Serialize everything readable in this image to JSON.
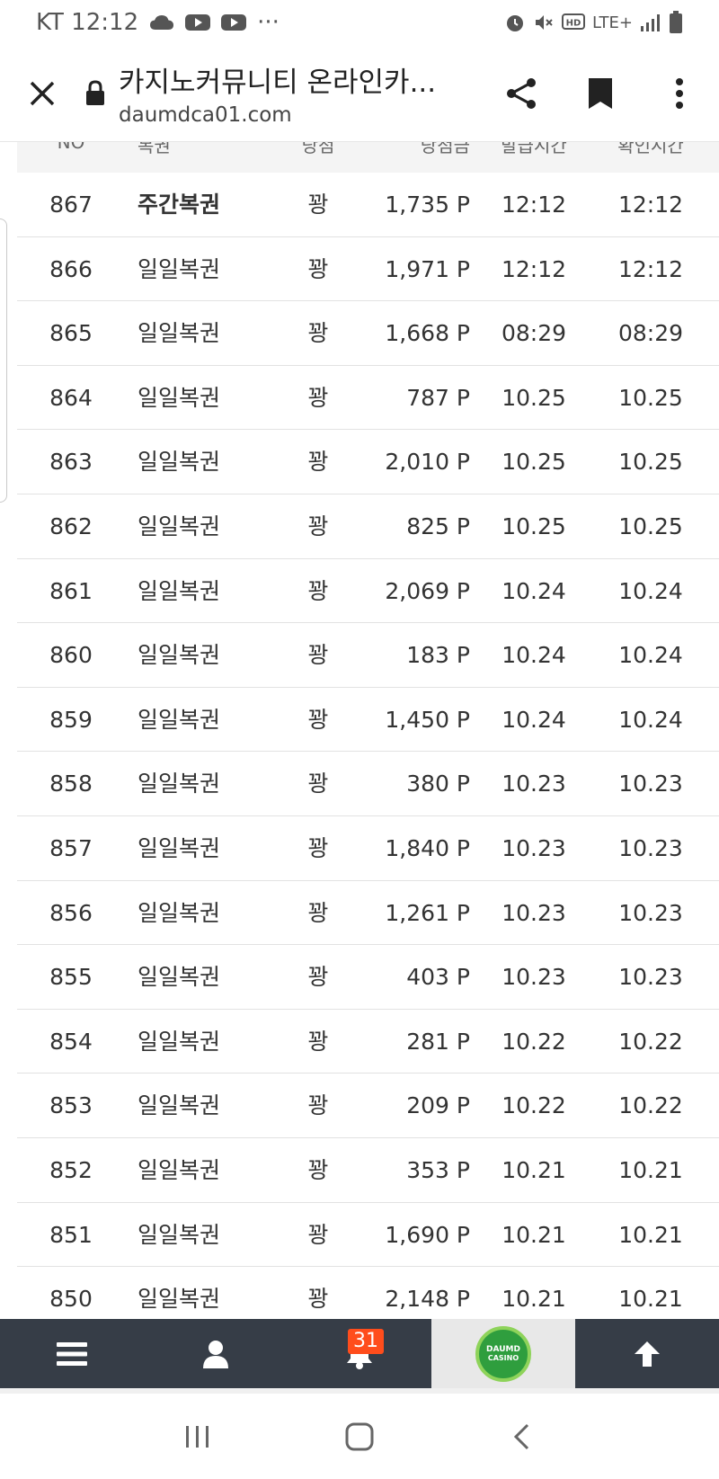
{
  "status_bar": {
    "carrier_time": "KT 12:12",
    "overflow": "···",
    "network": "LTE+"
  },
  "url_bar": {
    "title": "카지노커뮤니티 온라인카...",
    "domain": "daumdca01.com"
  },
  "table": {
    "columns": [
      "NO",
      "복권",
      "당첨",
      "당첨금",
      "발급시간",
      "확인시간"
    ],
    "rows": [
      {
        "no": "867",
        "type": "주간복권",
        "result": "꽝",
        "amount": "1,735 P",
        "issued": "12:12",
        "checked": "12:12"
      },
      {
        "no": "866",
        "type": "일일복권",
        "result": "꽝",
        "amount": "1,971 P",
        "issued": "12:12",
        "checked": "12:12"
      },
      {
        "no": "865",
        "type": "일일복권",
        "result": "꽝",
        "amount": "1,668 P",
        "issued": "08:29",
        "checked": "08:29"
      },
      {
        "no": "864",
        "type": "일일복권",
        "result": "꽝",
        "amount": "787 P",
        "issued": "10.25",
        "checked": "10.25"
      },
      {
        "no": "863",
        "type": "일일복권",
        "result": "꽝",
        "amount": "2,010 P",
        "issued": "10.25",
        "checked": "10.25"
      },
      {
        "no": "862",
        "type": "일일복권",
        "result": "꽝",
        "amount": "825 P",
        "issued": "10.25",
        "checked": "10.25"
      },
      {
        "no": "861",
        "type": "일일복권",
        "result": "꽝",
        "amount": "2,069 P",
        "issued": "10.24",
        "checked": "10.24"
      },
      {
        "no": "860",
        "type": "일일복권",
        "result": "꽝",
        "amount": "183 P",
        "issued": "10.24",
        "checked": "10.24"
      },
      {
        "no": "859",
        "type": "일일복권",
        "result": "꽝",
        "amount": "1,450 P",
        "issued": "10.24",
        "checked": "10.24"
      },
      {
        "no": "858",
        "type": "일일복권",
        "result": "꽝",
        "amount": "380 P",
        "issued": "10.23",
        "checked": "10.23"
      },
      {
        "no": "857",
        "type": "일일복권",
        "result": "꽝",
        "amount": "1,840 P",
        "issued": "10.23",
        "checked": "10.23"
      },
      {
        "no": "856",
        "type": "일일복권",
        "result": "꽝",
        "amount": "1,261 P",
        "issued": "10.23",
        "checked": "10.23"
      },
      {
        "no": "855",
        "type": "일일복권",
        "result": "꽝",
        "amount": "403 P",
        "issued": "10.23",
        "checked": "10.23"
      },
      {
        "no": "854",
        "type": "일일복권",
        "result": "꽝",
        "amount": "281 P",
        "issued": "10.22",
        "checked": "10.22"
      },
      {
        "no": "853",
        "type": "일일복권",
        "result": "꽝",
        "amount": "209 P",
        "issued": "10.22",
        "checked": "10.22"
      },
      {
        "no": "852",
        "type": "일일복권",
        "result": "꽝",
        "amount": "353 P",
        "issued": "10.21",
        "checked": "10.21"
      },
      {
        "no": "851",
        "type": "일일복권",
        "result": "꽝",
        "amount": "1,690 P",
        "issued": "10.21",
        "checked": "10.21"
      },
      {
        "no": "850",
        "type": "일일복권",
        "result": "꽝",
        "amount": "2,148 P",
        "issued": "10.21",
        "checked": "10.21"
      }
    ]
  },
  "bottom_nav": {
    "notification_count": "31",
    "logo_line1": "DAUMD",
    "logo_line2": "CASINO"
  },
  "colors": {
    "nav_bg": "#363d47",
    "badge": "#ff4d1c",
    "logo_green": "#2f9e3e"
  },
  "icons": [
    "close-icon",
    "lock-icon",
    "share-icon",
    "bookmark-icon",
    "more-vert-icon",
    "menu-icon",
    "user-icon",
    "bell-icon",
    "arrow-up-icon",
    "recent-apps-icon",
    "home-icon",
    "back-icon"
  ]
}
